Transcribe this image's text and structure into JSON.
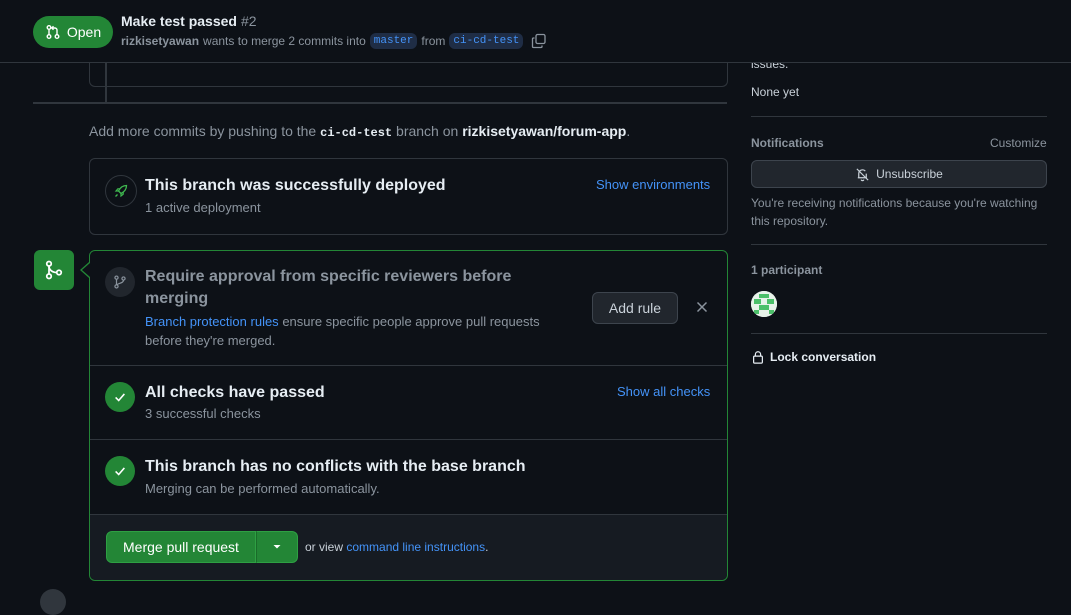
{
  "header": {
    "state_label": "Open",
    "title": "Make test passed",
    "number": "#2",
    "author": "rizkisetyawan",
    "merge_text": "wants to merge 2 commits into",
    "base_branch": "master",
    "from_text": "from",
    "head_branch": "ci-cd-test"
  },
  "timeline": {
    "add_commits_prefix": "Add more commits by pushing to the",
    "branch": "ci-cd-test",
    "branch_on": "branch on",
    "repo": "rizkisetyawan/forum-app",
    "period": "."
  },
  "deployment": {
    "title": "This branch was successfully deployed",
    "subtitle": "1 active deployment",
    "link": "Show environments"
  },
  "merge_box": {
    "approval_title": "Require approval from specific reviewers before merging",
    "approval_link": "Branch protection rules",
    "approval_desc": "ensure specific people approve pull requests before they're merged.",
    "add_rule": "Add rule",
    "checks_title": "All checks have passed",
    "checks_sub": "3 successful checks",
    "checks_link": "Show all checks",
    "conflicts_title": "This branch has no conflicts with the base branch",
    "conflicts_sub": "Merging can be performed automatically.",
    "merge_button": "Merge pull request",
    "or_view": "or view",
    "cli_link": "command line instructions",
    "cli_period": "."
  },
  "sidebar": {
    "issues_fragment": "issues.",
    "none_yet": "None yet",
    "notifications_heading": "Notifications",
    "customize": "Customize",
    "unsubscribe": "Unsubscribe",
    "notif_desc": "You're receiving notifications because you're watching this repository.",
    "participants_heading": "1 participant",
    "lock": "Lock conversation"
  },
  "colors": {
    "accent_green": "#238636",
    "link_blue": "#4493f8",
    "background": "#0d1117"
  }
}
